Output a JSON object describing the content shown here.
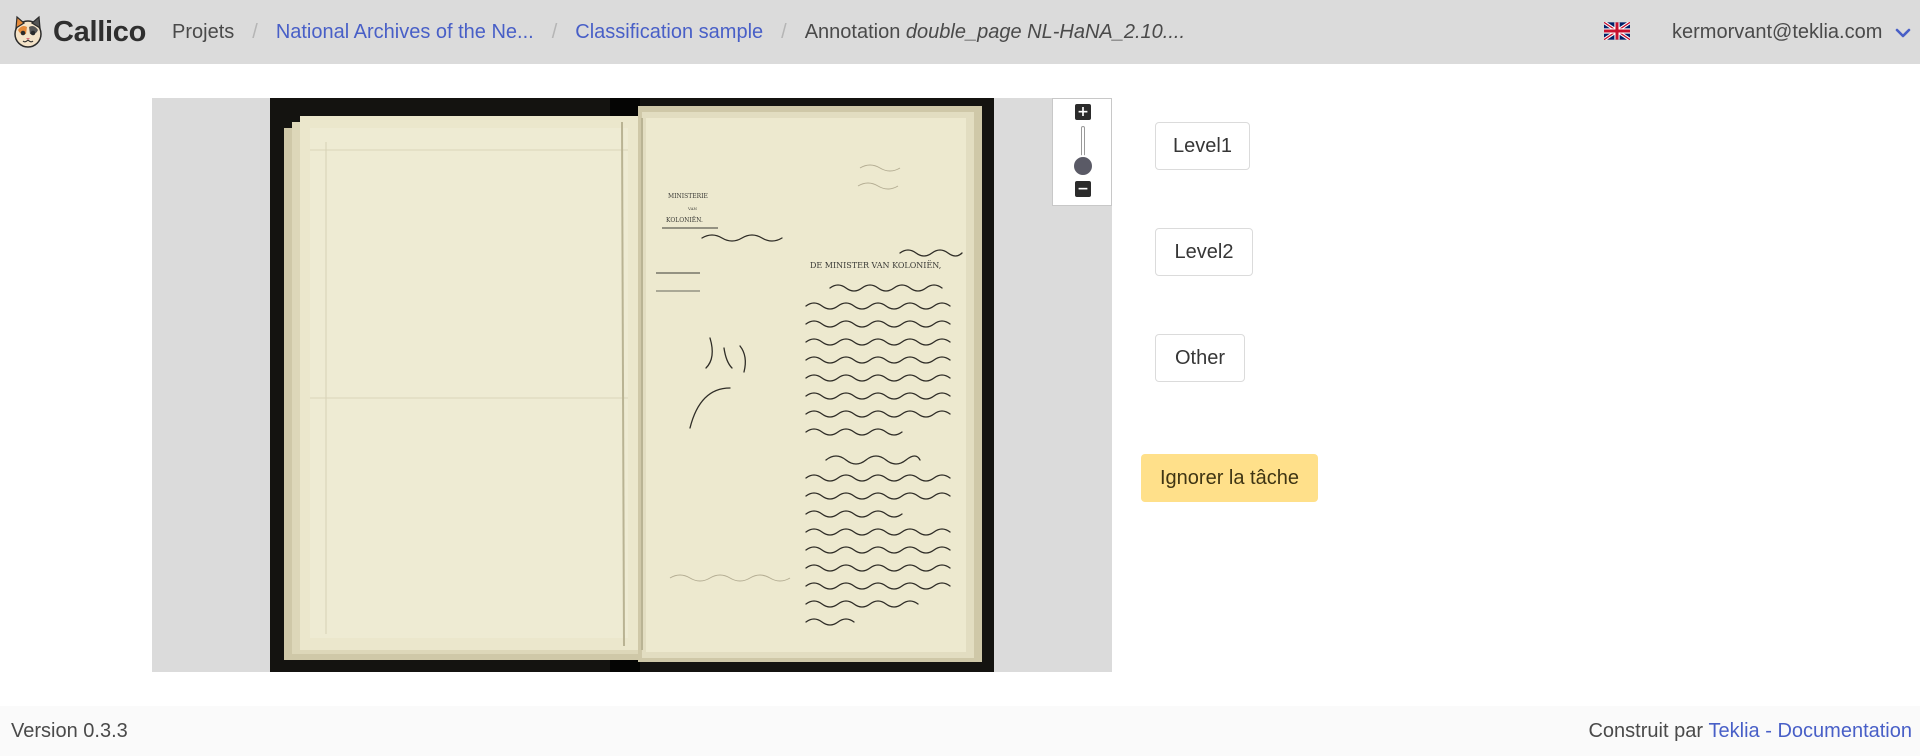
{
  "app": {
    "name": "Callico",
    "logo": "callico-cat-logo"
  },
  "breadcrumb": {
    "items": [
      {
        "label": "Projets",
        "type": "plain"
      },
      {
        "label": "National Archives of the Ne...",
        "type": "link"
      },
      {
        "label": "Classification sample",
        "type": "link"
      },
      {
        "prefix": "Annotation ",
        "label": "double_page NL-HaNA_2.10....",
        "type": "current"
      }
    ]
  },
  "header": {
    "language_icon": "uk-flag-icon",
    "user_email": "kermorvant@teklia.com",
    "user_menu_icon": "chevron-down-icon"
  },
  "viewer": {
    "image": "scanned-double-page-document",
    "zoom_controls": [
      "zoom-in-icon",
      "zoom-slider",
      "zoom-out-icon"
    ]
  },
  "classes": {
    "level1": "Level1",
    "level2": "Level2",
    "other": "Other"
  },
  "actions": {
    "ignore_task": "Ignorer la tâche"
  },
  "footer": {
    "version": "Version 0.3.3",
    "built_by": "Construit par",
    "teklia": "Teklia",
    "dash": " - ",
    "documentation": "Documentation"
  },
  "colors": {
    "navbar": "#dbdbdb",
    "link": "#485fc7",
    "warning": "#ffe08a",
    "footer": "#fafafa"
  }
}
